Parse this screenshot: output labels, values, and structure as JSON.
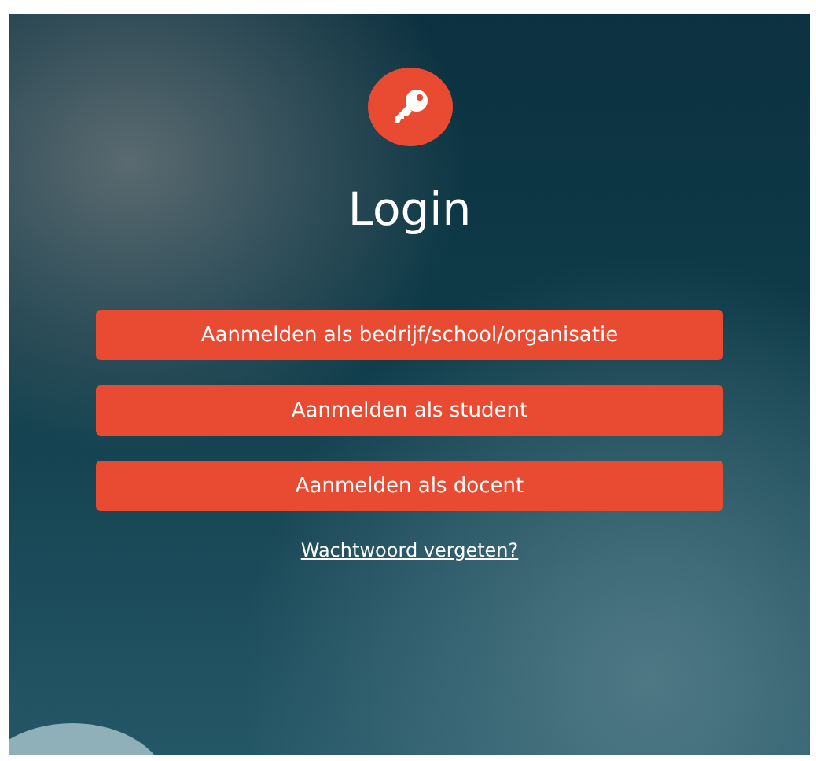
{
  "title": "Login",
  "buttons": [
    {
      "label": "Aanmelden als bedrijf/school/organisatie"
    },
    {
      "label": "Aanmelden als student"
    },
    {
      "label": "Aanmelden als docent"
    }
  ],
  "forgot_link": "Wachtwoord vergeten?"
}
